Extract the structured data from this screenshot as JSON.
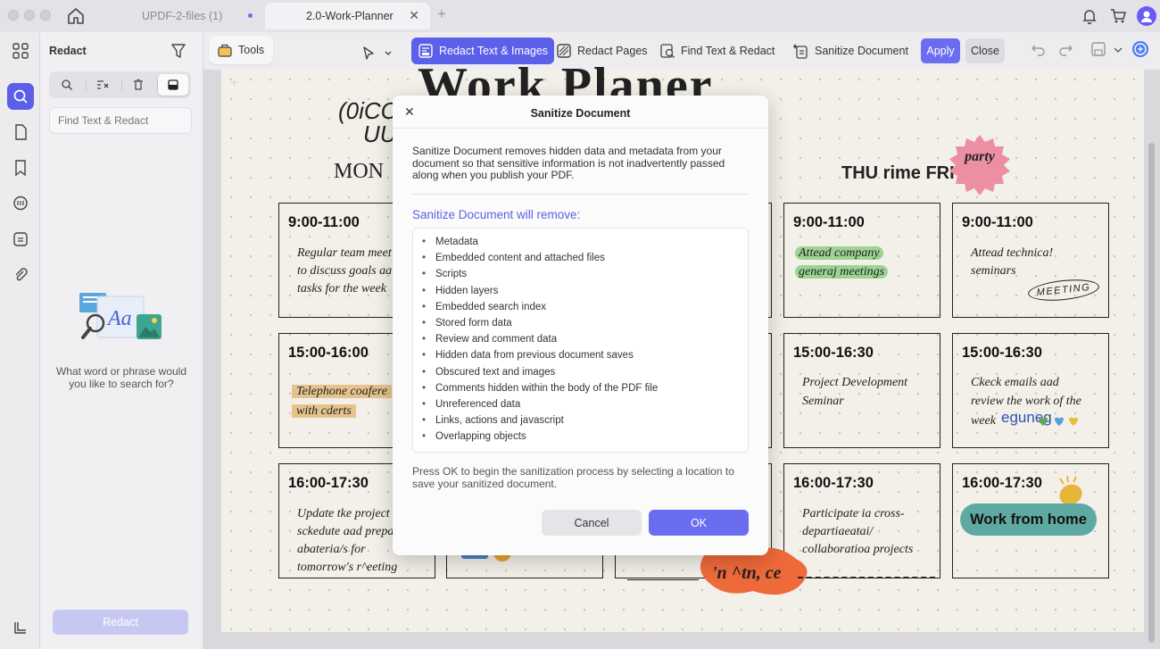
{
  "window": {
    "tabs": [
      {
        "label": "UPDF-2-files (1)"
      },
      {
        "label": "2.0-Work-Planner"
      }
    ]
  },
  "redact_panel": {
    "title": "Redact",
    "search_placeholder": "Find Text & Redact",
    "empty_message": "What word or phrase would you like to search for?",
    "redact_button": "Redact"
  },
  "toolbar": {
    "tools": "Tools",
    "redact_text_images": "Redact Text & Images",
    "redact_pages": "Redact Pages",
    "find_text_redact": "Find Text & Redact",
    "sanitize_document": "Sanitize Document",
    "apply": "Apply",
    "close": "Close"
  },
  "document": {
    "title": "Work Planer",
    "scribble_line1": "(0iCC",
    "scribble_line2": "UU",
    "day_mon": "MON",
    "day_thu_fri": "THU rime FRI",
    "party_label": "party",
    "cells": {
      "c1_time": "9:00-11:00",
      "c1_lines": [
        "Regular team meet",
        "to discuss goals aa",
        "tasks for the week"
      ],
      "c2_time": "15:00-16:00",
      "c2_lines": [
        "Telephone coafere",
        "with cderts"
      ],
      "c3_time": "16:00-17:30",
      "c3_lines": [
        "Update tke project",
        "sckedute aad prepa",
        "abateria/s for",
        "tomorrow's r^eeting"
      ],
      "c4_time": "9:00-11:00",
      "c4_lines": [
        "Attead company",
        "generaj meetings"
      ],
      "c5_time": "15:00-16:30",
      "c5_lines": [
        "Project Development",
        "Seminar"
      ],
      "c6_time": "16:00-17:30",
      "c6_lines": [
        "Participate ia cross-",
        "departiaeatai/",
        "collaboratioa projects"
      ],
      "c7_time": "9:00-11:00",
      "c7_lines": [
        "Attead technica!",
        "seminars"
      ],
      "c7_stamp": "MEETING",
      "c8_time": "15:00-16:30",
      "c8_lines": [
        "Ckeck emails aad",
        "review the work of the",
        "week"
      ],
      "c8_tail": "eguneg",
      "c9_time": "16:00-17:30",
      "c9_badge": "Work from home"
    },
    "blob_text": "'n ^tn, ce"
  },
  "dialog": {
    "title": "Sanitize Document",
    "description": "Sanitize Document removes hidden data and metadata from your document so that sensitive information is not inadvertently passed along when you publish your PDF.",
    "subtitle": "Sanitize Document will remove:",
    "items": [
      "Metadata",
      "Embedded content and attached files",
      "Scripts",
      "Hidden layers",
      "Embedded search index",
      "Stored form data",
      "Review and comment data",
      "Hidden data from previous document saves",
      "Obscured text and images",
      "Comments hidden within the body of the PDF file",
      "Unreferenced data",
      "Links, actions and javascript",
      "Overlapping objects"
    ],
    "footer": "Press OK to begin the sanitization process by selecting a location to save your sanitized document.",
    "cancel": "Cancel",
    "ok": "OK"
  },
  "colors": {
    "accent": "#6b6df0",
    "accent_dark": "#5c5fe8",
    "paper": "#f3efe9"
  }
}
